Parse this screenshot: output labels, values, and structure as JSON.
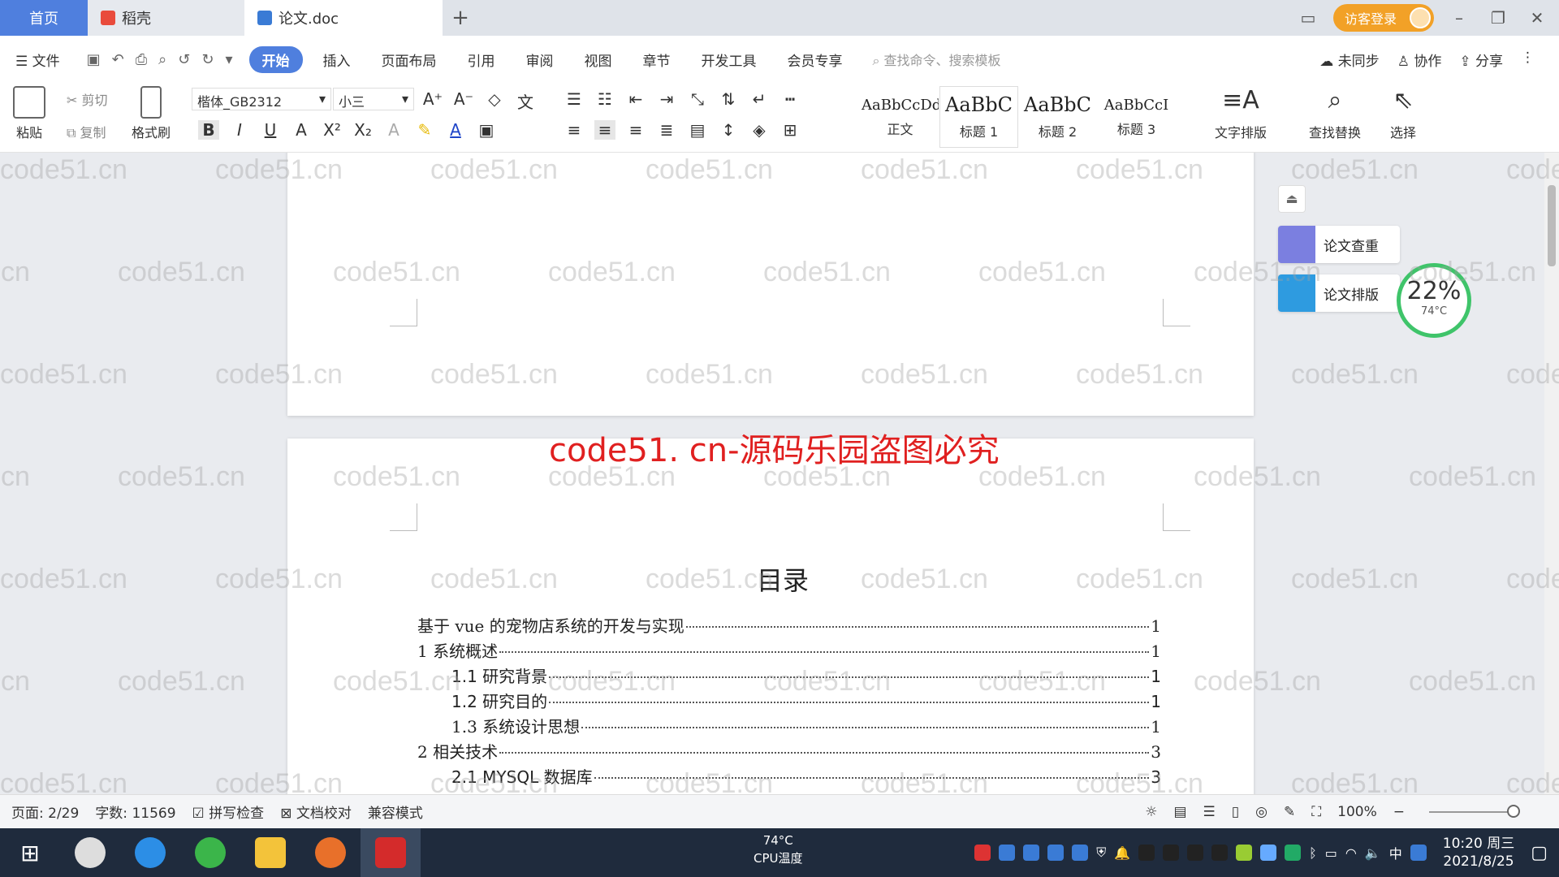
{
  "tabs": {
    "home": "首页",
    "daoke": "稻壳",
    "doc": "论文.doc",
    "new_tab": "+"
  },
  "account": {
    "login": "访客登录"
  },
  "menu": {
    "file": "文件",
    "items": [
      "开始",
      "插入",
      "页面布局",
      "引用",
      "审阅",
      "视图",
      "章节",
      "开发工具",
      "会员专享"
    ],
    "search_placeholder": "查找命令、搜索模板",
    "sync": "未同步",
    "collab": "协作",
    "share": "分享"
  },
  "ribbon": {
    "paste": "粘贴",
    "cut": "剪切",
    "copy": "复制",
    "format_painter": "格式刷",
    "font_name": "楷体_GB2312",
    "font_size": "小三",
    "styles": [
      {
        "preview": "AaBbCcDd",
        "name": "正文"
      },
      {
        "preview": "AaBbC",
        "name": "标题 1"
      },
      {
        "preview": "AaBbC",
        "name": "标题 2"
      },
      {
        "preview": "AaBbCcI",
        "name": "标题 3"
      }
    ],
    "text_layout": "文字排版",
    "find_replace": "查找替换",
    "select": "选择"
  },
  "side": {
    "check": "论文查重",
    "layout": "论文排版",
    "gauge_pct": "22%",
    "gauge_temp": "74°C"
  },
  "watermark": "code51.cn",
  "piracy_notice": "code51. cn-源码乐园盗图必究",
  "toc": {
    "title": "目录",
    "entries": [
      {
        "text": "基于 vue 的宠物店系统的开发与实现",
        "page": "1"
      },
      {
        "text": "1 系统概述",
        "page": "1"
      },
      {
        "text": "1.1 研究背景",
        "page": "1"
      },
      {
        "text": "1.2 研究目的",
        "page": "1"
      },
      {
        "text": "1.3 系统设计思想",
        "page": "1"
      },
      {
        "text": "2 相关技术",
        "page": "3"
      },
      {
        "text": "2.1 MYSQL 数据库",
        "page": "3"
      }
    ]
  },
  "status": {
    "page": "页面: 2/29",
    "words": "字数: 11569",
    "spell": "拼写检查",
    "proof": "文档校对",
    "compat": "兼容模式",
    "zoom": "100%"
  },
  "taskbar": {
    "cpu_value": "74°C",
    "cpu_label": "CPU温度",
    "time": "10:20 周三",
    "date": "2021/8/25",
    "ime": "中"
  }
}
